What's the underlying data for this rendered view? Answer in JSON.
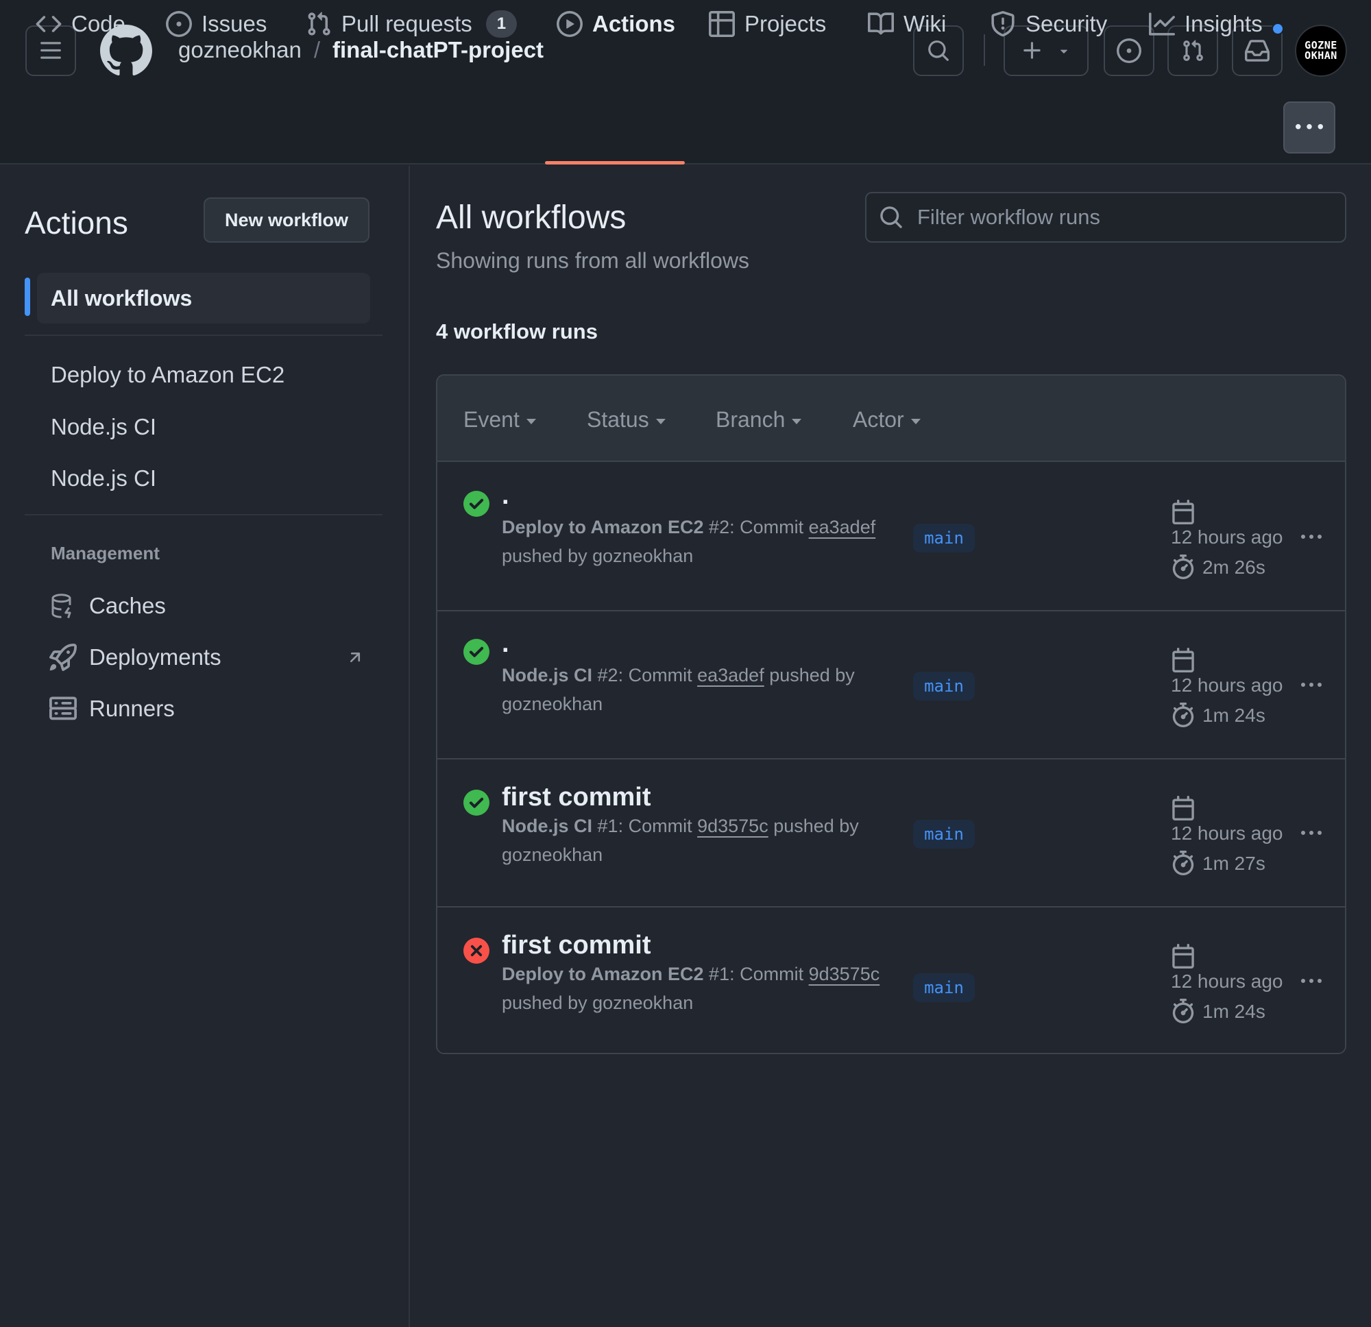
{
  "header": {
    "owner": "gozneokhan",
    "separator": "/",
    "repo": "final-chatPT-project",
    "avatar_line1": "GOZNE",
    "avatar_line2": "OKHAN",
    "has_notification": true
  },
  "repo_nav": {
    "tabs": [
      {
        "label": "Code",
        "icon": "code-icon"
      },
      {
        "label": "Issues",
        "icon": "issue-opened-icon"
      },
      {
        "label": "Pull requests",
        "icon": "git-pull-request-icon",
        "count": "1"
      },
      {
        "label": "Actions",
        "icon": "play-icon",
        "active": true
      },
      {
        "label": "Projects",
        "icon": "table-icon"
      },
      {
        "label": "Wiki",
        "icon": "book-icon"
      },
      {
        "label": "Security",
        "icon": "shield-icon"
      },
      {
        "label": "Insights",
        "icon": "graph-icon"
      }
    ]
  },
  "sidebar": {
    "title": "Actions",
    "new_workflow_label": "New workflow",
    "all_workflows_label": "All workflows",
    "workflows": [
      "Deploy to Amazon EC2",
      "Node.js CI",
      "Node.js CI"
    ],
    "management_heading": "Management",
    "management_items": [
      {
        "label": "Caches",
        "icon": "database-icon"
      },
      {
        "label": "Deployments",
        "icon": "rocket-icon",
        "external": true
      },
      {
        "label": "Runners",
        "icon": "server-icon"
      }
    ]
  },
  "main": {
    "title": "All workflows",
    "subtitle": "Showing runs from all workflows",
    "filter_placeholder": "Filter workflow runs",
    "filter_value": "",
    "runs_count_label": "4 workflow runs",
    "filters": [
      "Event",
      "Status",
      "Branch",
      "Actor"
    ],
    "runs": [
      {
        "status": "success",
        "title": ".",
        "workflow": "Deploy to Amazon EC2",
        "run_number": "#2",
        "commit_prefix": ": Commit ",
        "sha": "ea3adef",
        "pushed_by": " pushed by gozneokhan",
        "branch": "main",
        "time_ago": "12 hours ago",
        "duration": "2m 26s"
      },
      {
        "status": "success",
        "title": ".",
        "workflow": "Node.js CI",
        "run_number": "#2",
        "commit_prefix": ": Commit ",
        "sha": "ea3adef",
        "pushed_by": " pushed by gozneokhan",
        "branch": "main",
        "time_ago": "12 hours ago",
        "duration": "1m 24s"
      },
      {
        "status": "success",
        "title": "first commit",
        "workflow": "Node.js CI",
        "run_number": "#1",
        "commit_prefix": ": Commit ",
        "sha": "9d3575c",
        "pushed_by": " pushed by gozneokhan",
        "branch": "main",
        "time_ago": "12 hours ago",
        "duration": "1m 27s"
      },
      {
        "status": "failure",
        "title": "first commit",
        "workflow": "Deploy to Amazon EC2",
        "run_number": "#1",
        "commit_prefix": ": Commit ",
        "sha": "9d3575c",
        "pushed_by": " pushed by gozneokhan",
        "branch": "main",
        "time_ago": "12 hours ago",
        "duration": "1m 24s"
      }
    ]
  },
  "colors": {
    "success": "#3fb950",
    "failure": "#f85149",
    "accent": "#4493f8",
    "active_tab_underline": "#f78166",
    "background": "#22262e",
    "header_background": "#1c2027"
  }
}
